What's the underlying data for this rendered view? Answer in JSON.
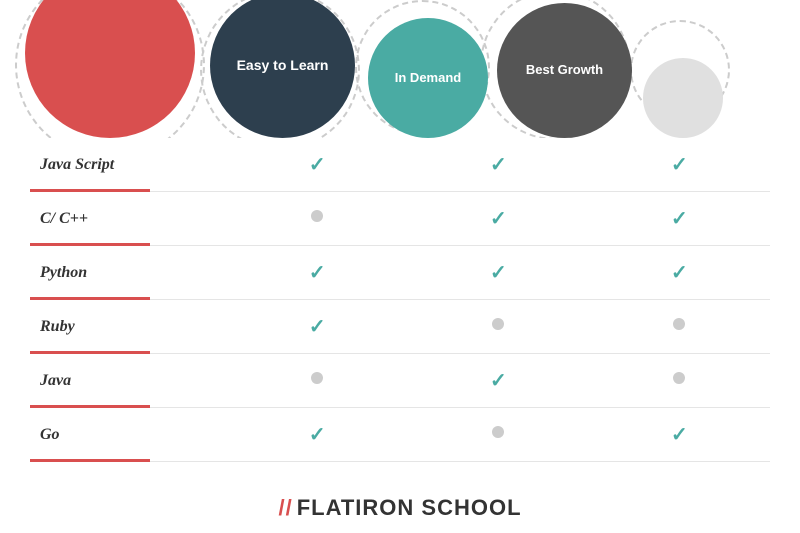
{
  "header": {
    "bubbles": [
      {
        "id": "easy",
        "label": "Easy to Learn",
        "color": "#2d3f4e",
        "size": 140
      },
      {
        "id": "demand",
        "label": "In Demand",
        "color": "#4aaba3",
        "size": 120
      },
      {
        "id": "growth",
        "label": "Best Growth",
        "color": "#555555",
        "size": 130
      },
      {
        "id": "small",
        "label": "",
        "color": "#e0e0e0",
        "size": 80
      }
    ]
  },
  "table": {
    "columns": [
      "",
      "Easy to Learn",
      "In Demand",
      "Best Growth"
    ],
    "rows": [
      {
        "lang": "Java Script",
        "easy": "check",
        "demand": "check",
        "growth": "check"
      },
      {
        "lang": "C/ C++",
        "easy": "dot",
        "demand": "check",
        "growth": "check"
      },
      {
        "lang": "Python",
        "easy": "check",
        "demand": "check",
        "growth": "check"
      },
      {
        "lang": "Ruby",
        "easy": "check",
        "demand": "dot",
        "growth": "dot"
      },
      {
        "lang": "Java",
        "easy": "dot",
        "demand": "check",
        "growth": "dot"
      },
      {
        "lang": "Go",
        "easy": "check",
        "demand": "dot",
        "growth": "check"
      }
    ]
  },
  "footer": {
    "slash": "//",
    "name": "FLATIRON SCHOOL"
  },
  "colors": {
    "red": "#d94f4f",
    "teal": "#4aaba3",
    "dark": "#2d3f4e",
    "gray": "#555555"
  }
}
